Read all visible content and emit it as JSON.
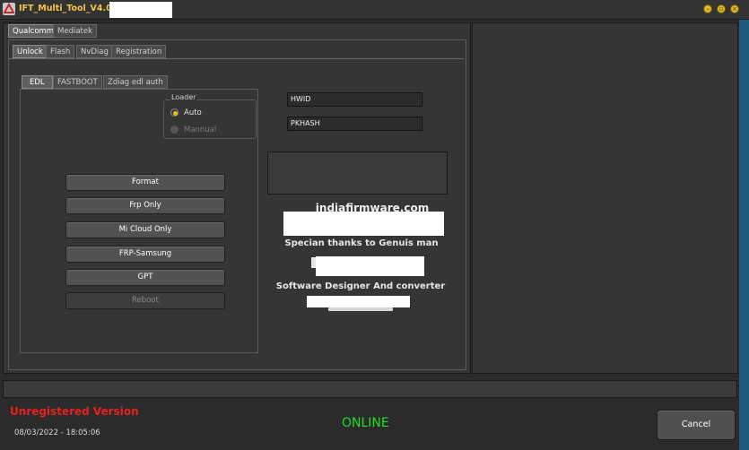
{
  "window": {
    "title": "IFT_Multi_Tool_V4.0(",
    "controls": [
      "minimize",
      "restore",
      "close"
    ]
  },
  "tabs_level1": [
    {
      "label": "Qualcomm",
      "active": true
    },
    {
      "label": "Mediatek",
      "active": false
    }
  ],
  "tabs_level2": [
    {
      "label": "Unlock",
      "active": true
    },
    {
      "label": "Flash",
      "active": false
    },
    {
      "label": "NvDiag",
      "active": false
    },
    {
      "label": "Registration",
      "active": false
    }
  ],
  "tabs_level3": [
    {
      "label": "EDL",
      "active": true
    },
    {
      "label": "FASTBOOT",
      "active": false
    },
    {
      "label": "Zdiag edl auth",
      "active": false
    }
  ],
  "loader": {
    "title": "Loader",
    "options": [
      {
        "label": "Auto",
        "selected": true,
        "enabled": true
      },
      {
        "label": "Mannual",
        "selected": false,
        "enabled": false
      }
    ]
  },
  "actions": [
    {
      "label": "Format",
      "enabled": true
    },
    {
      "label": "Frp Only",
      "enabled": true
    },
    {
      "label": "Mi Cloud Only",
      "enabled": true
    },
    {
      "label": "FRP-Samsung",
      "enabled": true
    },
    {
      "label": "GPT",
      "enabled": true
    },
    {
      "label": "Reboot",
      "enabled": false
    }
  ],
  "fields": {
    "hwid": "HWID",
    "pkhash": "PKHASH"
  },
  "credits": {
    "website": "indiafirmware.com",
    "thanks": "Specian thanks to Genuis man",
    "designer": "Software Designer And converter"
  },
  "status": {
    "registration": "Unregistered Version",
    "datetime": "08/03/2022 - 18:05:06",
    "connection": "ONLINE"
  },
  "buttons": {
    "cancel": "Cancel"
  },
  "colors": {
    "title_accent": "#f5c542",
    "unregistered": "#e82020",
    "online": "#20e020",
    "radio_selected": "#f0b820"
  }
}
